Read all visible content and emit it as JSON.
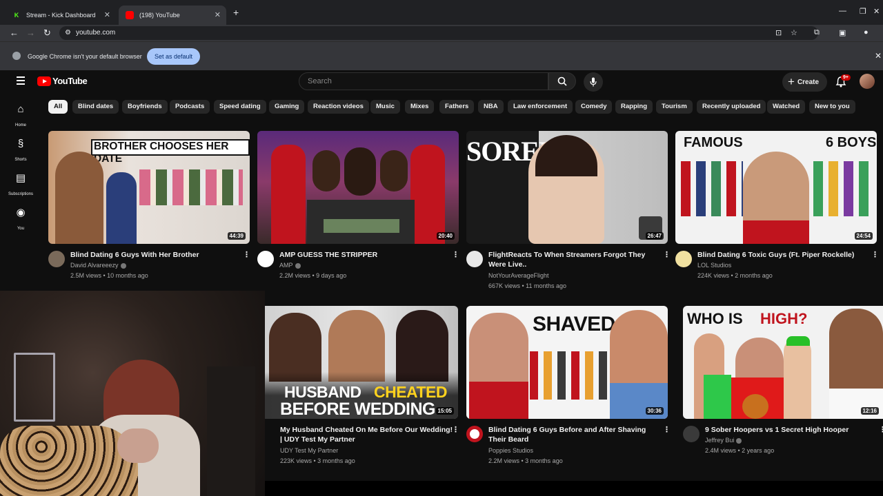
{
  "browser": {
    "tabs": [
      {
        "title": "Stream - Kick Dashboard",
        "favicon": "kick-icon"
      },
      {
        "title": "(198) YouTube",
        "favicon": "youtube-icon"
      }
    ],
    "url": "youtube.com",
    "infobar": {
      "message": "Google Chrome isn't your default browser",
      "button": "Set as default"
    }
  },
  "youtube": {
    "logo_text": "YouTube",
    "search_placeholder": "Search",
    "create_label": "Create",
    "notifications_badge": "9+",
    "guide": [
      {
        "label": "Home",
        "icon": "home-icon"
      },
      {
        "label": "Shorts",
        "icon": "shorts-icon"
      },
      {
        "label": "Subscriptions",
        "icon": "subscriptions-icon"
      },
      {
        "label": "You",
        "icon": "you-icon"
      }
    ],
    "chips": [
      "All",
      "Blind dates",
      "Boyfriends",
      "Podcasts",
      "Speed dating",
      "Gaming",
      "Reaction videos",
      "Music",
      "Mixes",
      "Fathers",
      "NBA",
      "Law enforcement",
      "Comedy",
      "Rapping",
      "Tourism",
      "Recently uploaded",
      "Watched",
      "New to you"
    ],
    "videos": [
      {
        "title": "Blind Dating 6 Guys With Her Brother",
        "channel": "David Alvareeezy",
        "meta": "2.5M views • 10 months ago",
        "duration": "44:39",
        "thumb_text": "BROTHER CHOOSES HER DATE"
      },
      {
        "title": "AMP GUESS THE STRIPPER",
        "channel": "AMP",
        "meta": "2.2M views • 9 days ago",
        "duration": "20:40",
        "thumb_text": ""
      },
      {
        "title_line1": "FlightReacts To When Streamers Forgot They",
        "title_line2": "Were Live..",
        "channel": "NotYourAverageFlight",
        "meta": "667K views • 11 months ago",
        "duration": "26:47",
        "thumb_text": "SORED"
      },
      {
        "title": "Blind Dating 6 Toxic Guys (Ft. Piper Rockelle)",
        "channel": "LOL Studios",
        "meta": "224K views • 2 months ago",
        "duration": "24:54",
        "thumb_text_left": "FAMOUS",
        "thumb_text_right": "6 BOYS"
      },
      {
        "title_line1": "My Husband Cheated On Me Before Our Wedding!",
        "title_line2": "| UDY Test My Partner",
        "channel": "UDY Test My Partner",
        "meta": "223K views • 3 months ago",
        "duration": "15:05",
        "thumb_text_1": "HUSBAND",
        "thumb_text_2": "CHEATED",
        "thumb_text_3": "BEFORE WEDDING"
      },
      {
        "title_line1": "Blind Dating 6 Guys Before and After Shaving",
        "title_line2": "Their Beard",
        "channel": "Poppies Studios",
        "meta": "2.2M views • 3 months ago",
        "duration": "30:36",
        "thumb_text": "SHAVED"
      },
      {
        "title": "9 Sober Hoopers vs 1 Secret High Hooper",
        "channel": "Jeffrey Bui",
        "meta": "2.4M views • 2 years ago",
        "duration": "12:16",
        "thumb_text_1": "WHO IS",
        "thumb_text_2": "HIGH?"
      }
    ]
  },
  "colors": {
    "brand_red": "#ff0000",
    "bg": "#0f0f0f",
    "chip": "#272727",
    "link_blue": "#a8c7fa"
  }
}
